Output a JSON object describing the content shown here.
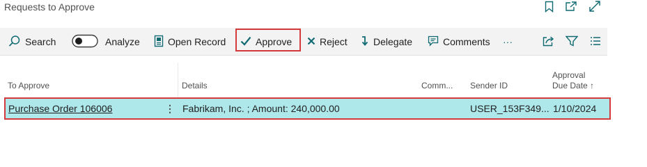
{
  "page": {
    "title": "Requests to Approve"
  },
  "top_icons": [
    "bookmark-icon",
    "open-in-new-window-icon",
    "expand-icon"
  ],
  "actions": {
    "search": "Search",
    "analyze": "Analyze",
    "open_record": "Open Record",
    "approve": "Approve",
    "reject": "Reject",
    "delegate": "Delegate",
    "comments": "Comments",
    "more": "···"
  },
  "columns": {
    "to_approve": "To Approve",
    "details": "Details",
    "comments": "Comm...",
    "sender_id": "Sender ID",
    "approval_due_line1": "Approval",
    "approval_due_line2": "Due Date ↑"
  },
  "rows": [
    {
      "to_approve": "Purchase Order 106006",
      "row_menu": "⋮",
      "details": "Fabrikam, Inc. ; Amount: 240,000.00",
      "comments": "",
      "sender_id": "USER_153F349...",
      "due_date": "1/10/2024"
    }
  ],
  "colors": {
    "accent": "#0f6a72",
    "selected_row": "#aee8ea",
    "highlight_border": "#d43a3a",
    "actionbar_bg": "#f3f3f3"
  }
}
